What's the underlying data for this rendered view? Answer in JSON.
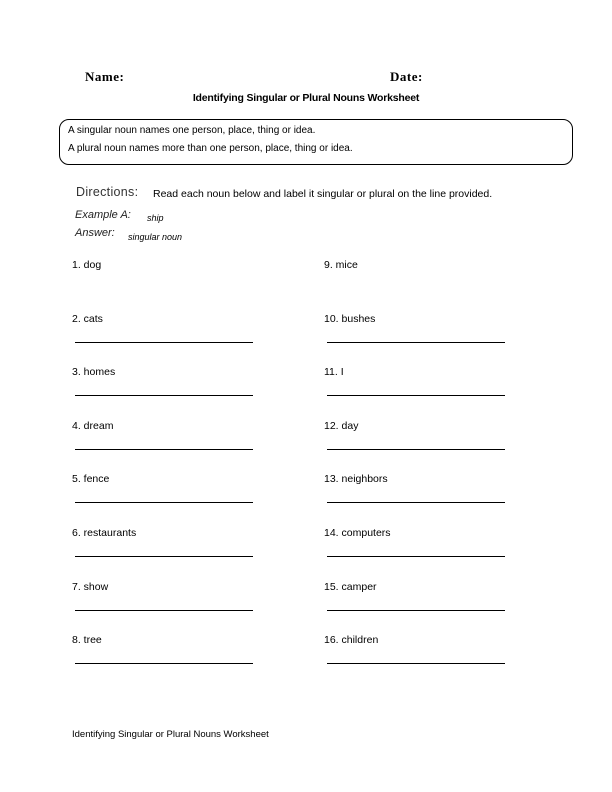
{
  "header": {
    "name_label": "Name:",
    "date_label": "Date:",
    "title": "Identifying Singular or Plural Nouns Worksheet"
  },
  "definitions": {
    "singular": "A singular noun names one person, place, thing or idea.",
    "plural": "A plural noun names more than one person, place, thing or idea."
  },
  "directions": {
    "label": "Directions:",
    "text": "Read each noun below and label it singular or plural on the line provided."
  },
  "example": {
    "label": "Example A:",
    "value": "ship",
    "answer_label": "Answer:",
    "answer_value": "singular noun"
  },
  "items_left": [
    {
      "label": "1. dog"
    },
    {
      "label": "2. cats"
    },
    {
      "label": "3. homes"
    },
    {
      "label": "4. dream"
    },
    {
      "label": "5. fence"
    },
    {
      "label": "6. restaurants"
    },
    {
      "label": "7. show"
    },
    {
      "label": "8. tree"
    }
  ],
  "items_right": [
    {
      "label": "9. mice"
    },
    {
      "label": "10. bushes"
    },
    {
      "label": "11. I"
    },
    {
      "label": "12. day"
    },
    {
      "label": "13. neighbors"
    },
    {
      "label": "14. computers"
    },
    {
      "label": "15. camper"
    },
    {
      "label": "16. children"
    }
  ],
  "footer": "Identifying Singular or Plural Nouns Worksheet"
}
